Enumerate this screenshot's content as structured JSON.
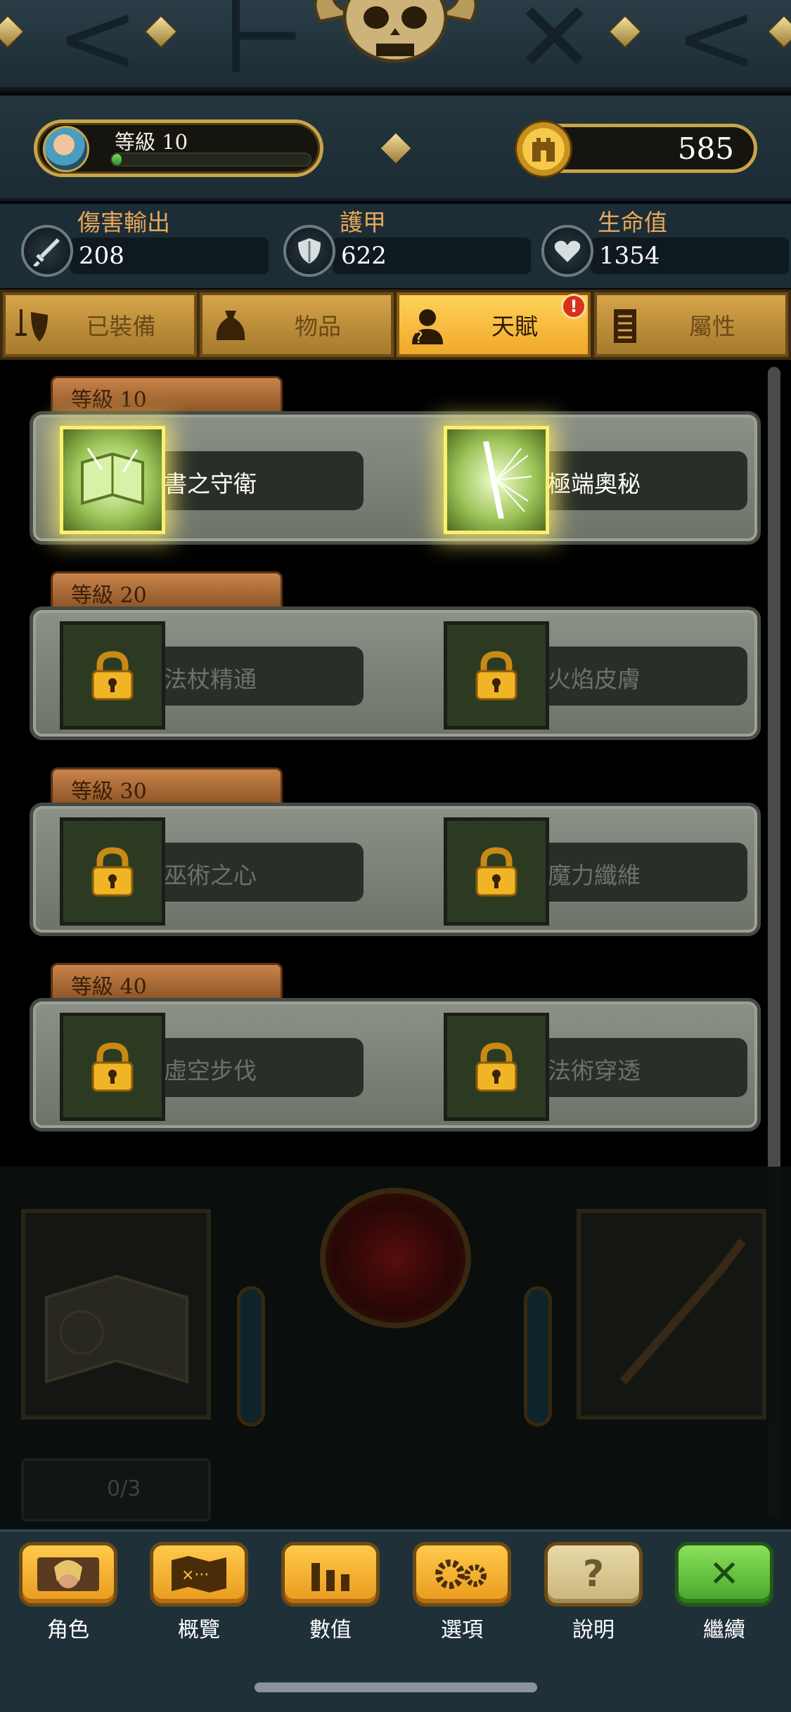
{
  "header": {
    "level_label": "等級 10",
    "xp_progress": 0.05,
    "gold": "585"
  },
  "stats": [
    {
      "label": "傷害輸出",
      "value": "208",
      "icon": "sword-icon"
    },
    {
      "label": "護甲",
      "value": "622",
      "icon": "shield-icon"
    },
    {
      "label": "生命值",
      "value": "1354",
      "icon": "heart-icon"
    }
  ],
  "tabs": [
    {
      "label": "已裝備",
      "icon": "sword-shield-icon",
      "active": false
    },
    {
      "label": "物品",
      "icon": "bag-icon",
      "active": false
    },
    {
      "label": "天賦",
      "icon": "talent-person-icon",
      "active": true,
      "badge": "!"
    },
    {
      "label": "屬性",
      "icon": "scroll-icon",
      "active": false
    }
  ],
  "tiers": [
    {
      "label": "等級 10",
      "talents": [
        {
          "name": "書之守衛",
          "locked": false,
          "icon": "book-ward-icon"
        },
        {
          "name": "極端奧秘",
          "locked": false,
          "icon": "arcane-burst-icon"
        }
      ]
    },
    {
      "label": "等級 20",
      "talents": [
        {
          "name": "法杖精通",
          "locked": true,
          "icon": "lock-icon"
        },
        {
          "name": "火焰皮膚",
          "locked": true,
          "icon": "lock-icon"
        }
      ]
    },
    {
      "label": "等級 30",
      "talents": [
        {
          "name": "巫術之心",
          "locked": true,
          "icon": "lock-icon"
        },
        {
          "name": "魔力纖維",
          "locked": true,
          "icon": "lock-icon"
        }
      ]
    },
    {
      "label": "等級 40",
      "talents": [
        {
          "name": "虛空步伐",
          "locked": true,
          "icon": "lock-icon"
        },
        {
          "name": "法術穿透",
          "locked": true,
          "icon": "lock-icon"
        }
      ]
    }
  ],
  "hud": {
    "potion_count": "0/3"
  },
  "nav": [
    {
      "label": "角色",
      "icon": "hero-portrait-icon",
      "style": "gold"
    },
    {
      "label": "概覽",
      "icon": "map-icon",
      "style": "gold"
    },
    {
      "label": "數值",
      "icon": "bar-chart-icon",
      "style": "gold"
    },
    {
      "label": "選項",
      "icon": "gear-icon",
      "style": "gold"
    },
    {
      "label": "說明",
      "icon": "question-icon",
      "style": "help"
    },
    {
      "label": "繼續",
      "icon": "close-icon",
      "style": "go"
    }
  ],
  "colors": {
    "accent_gold": "#c9a448",
    "stat_label": "#e6a85a",
    "active_tab": "#ffd25a",
    "glow": "#ffef70"
  }
}
